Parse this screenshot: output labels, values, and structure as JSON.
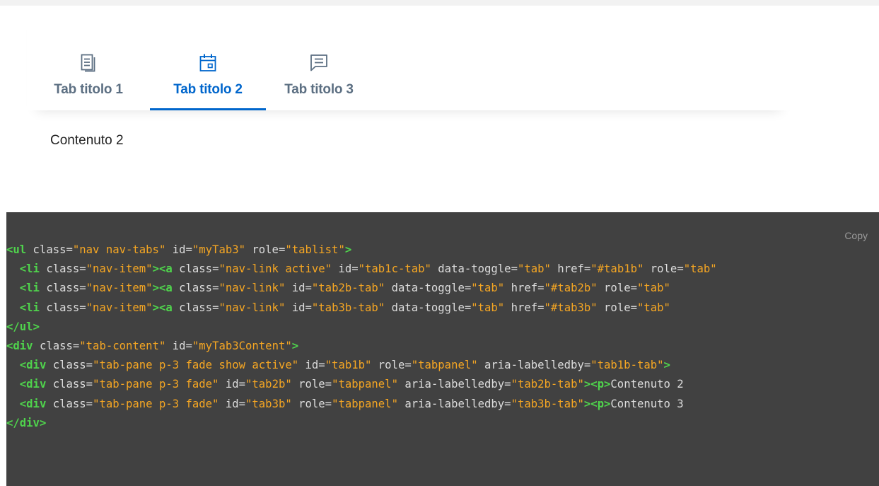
{
  "tabs": [
    {
      "label": "Tab titolo 1",
      "icon": "document-icon",
      "active": false
    },
    {
      "label": "Tab titolo 2",
      "icon": "calendar-icon",
      "active": true
    },
    {
      "label": "Tab titolo 3",
      "icon": "comment-icon",
      "active": false
    }
  ],
  "content": {
    "active_text": "Contenuto 2"
  },
  "code": {
    "copy_label": "Copy",
    "lines": [
      "<ul class=\"nav nav-tabs\" id=\"myTab3\" role=\"tablist\">",
      "  <li class=\"nav-item\"><a class=\"nav-link active\" id=\"tab1c-tab\" data-toggle=\"tab\" href=\"#tab1b\" role=\"tab\"",
      "  <li class=\"nav-item\"><a class=\"nav-link\" id=\"tab2b-tab\" data-toggle=\"tab\" href=\"#tab2b\" role=\"tab\"",
      "  <li class=\"nav-item\"><a class=\"nav-link\" id=\"tab3b-tab\" data-toggle=\"tab\" href=\"#tab3b\" role=\"tab\"",
      "</ul>",
      "<div class=\"tab-content\" id=\"myTab3Content\">",
      "  <div class=\"tab-pane p-3 fade show active\" id=\"tab1b\" role=\"tabpanel\" aria-labelledby=\"tab1b-tab\">",
      "  <div class=\"tab-pane p-3 fade\" id=\"tab2b\" role=\"tabpanel\" aria-labelledby=\"tab2b-tab\"><p>Contenuto 2",
      "  <div class=\"tab-pane p-3 fade\" id=\"tab3b\" role=\"tabpanel\" aria-labelledby=\"tab3b-tab\"><p>Contenuto 3",
      "</div>"
    ]
  },
  "colors": {
    "accent": "#0066cc",
    "tab_inactive": "#5c6f82",
    "code_bg": "#414141",
    "code_tag": "#4fd34c",
    "code_value": "#f5a623",
    "code_attr": "#dcdcdc"
  }
}
